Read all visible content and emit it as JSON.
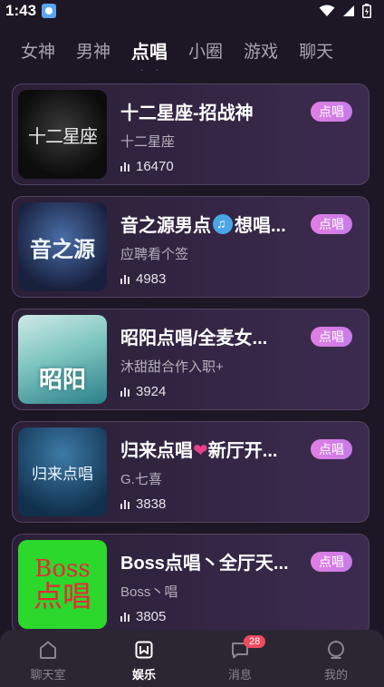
{
  "status_bar": {
    "time": "1:43"
  },
  "tabs": [
    {
      "label": "女神",
      "active": false
    },
    {
      "label": "男神",
      "active": false
    },
    {
      "label": "点唱",
      "active": true
    },
    {
      "label": "小圈",
      "active": false
    },
    {
      "label": "游戏",
      "active": false
    },
    {
      "label": "聊天",
      "active": false
    }
  ],
  "rooms": [
    {
      "title": "十二星座-招战神",
      "host": "十二星座",
      "count": "16470",
      "badge": "点唱",
      "cover_text": "十二星座"
    },
    {
      "title_a": "音之源男点",
      "title_b": "想唱...",
      "host": "应聘看个签",
      "count": "4983",
      "badge": "点唱",
      "cover_text": "音之源"
    },
    {
      "title": "昭阳点唱/全麦女...",
      "host": "沐甜甜合作入职+",
      "count": "3924",
      "badge": "点唱",
      "cover_text": "昭阳"
    },
    {
      "title_a": "归来点唱",
      "title_b": "新厅开...",
      "host": "G.七喜",
      "count": "3838",
      "badge": "点唱",
      "cover_text": "归来点唱"
    },
    {
      "title": "Boss点唱丶全厅天...",
      "host": "Boss丶唱",
      "count": "3805",
      "badge": "点唱",
      "cover_text_a": "Boss",
      "cover_text_b": "点唱"
    }
  ],
  "bottom_nav": [
    {
      "label": "聊天室",
      "icon": "home-icon"
    },
    {
      "label": "娱乐",
      "icon": "bookmark-icon"
    },
    {
      "label": "消息",
      "icon": "message-icon",
      "badge": "28"
    },
    {
      "label": "我的",
      "icon": "profile-icon"
    }
  ],
  "colors": {
    "accent": "#b58aff",
    "badge": "#d27de6",
    "background": "#1d1624"
  }
}
